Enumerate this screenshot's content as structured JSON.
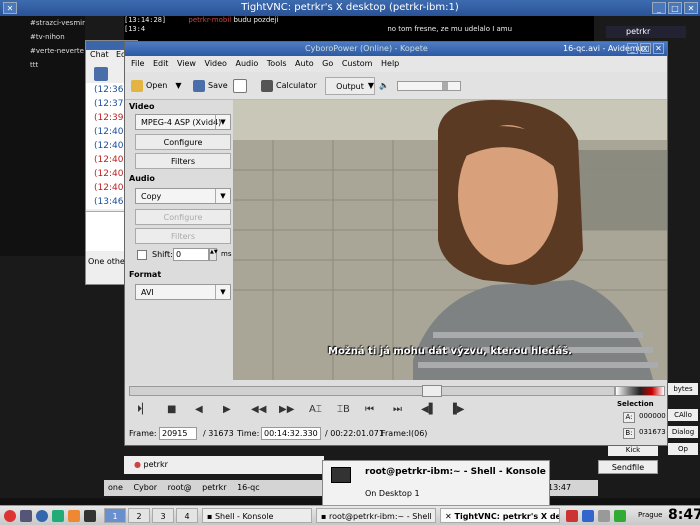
{
  "vnc": {
    "title": "TightVNC: petrkr's X desktop (petrkr-ibm:1)"
  },
  "irc": {
    "channels": [
      "#strazci-vesmiru",
      "#tv-nihon",
      "#verte-neverte",
      "ttt"
    ],
    "log": [
      {
        "time": "[13:14:28]",
        "nick": "petrkr-mobil",
        "text": "budu pozdeji"
      },
      {
        "time": "[13:4",
        "nick": "",
        "text": "no tom fresne, ze mu udelalo I amu"
      }
    ],
    "right_nick": "petrkr",
    "right_buttons": [
      "bytes",
      "CAllo",
      "Dialog",
      "Op",
      "Kick",
      "Sendfile"
    ]
  },
  "kopete": {
    "title": "CyboroPower (Online) - Kopete",
    "menu": [
      "Chat",
      "Edit"
    ],
    "times": [
      "(12:36:",
      "(12:37:",
      "(12:39:",
      "(12:40:",
      "(12:40:",
      "(12:40:",
      "(12:40:",
      "(12:40:",
      "(13:46:"
    ],
    "time_colors": [
      "#1a4fa0",
      "#1a4fa0",
      "#c02020",
      "#1a4fa0",
      "#1a4fa0",
      "#c02020",
      "#c02020",
      "#c02020",
      "#1a4fa0"
    ],
    "other_label": "One other p",
    "input_nick": "petrkr"
  },
  "avidemux": {
    "title": "16-qc.avi - Avidemux",
    "menu": [
      "File",
      "Edit",
      "View",
      "Video",
      "Audio",
      "Tools",
      "Auto",
      "Go",
      "Custom",
      "Help"
    ],
    "toolbar": {
      "open": "Open",
      "save": "Save",
      "calculator": "Calculator",
      "output": "Output"
    },
    "video_label": "Video",
    "video_codec": "MPEG-4 ASP (Xvid4)",
    "configure": "Configure",
    "filters": "Filters",
    "audio_label": "Audio",
    "audio_codec": "Copy",
    "shift_label": "Shift:",
    "shift_value": "0",
    "shift_unit": "ms",
    "format_label": "Format",
    "format_value": "AVI",
    "subtitle": "Možná ti já mohu dát výzvu, kterou hledáš.",
    "frame_label": "Frame:",
    "frame_value": "20915",
    "frame_total": "/ 31673",
    "time_label": "Time:",
    "time_value": "00:14:32.330",
    "time_total": "/ 00:22:01.071",
    "frame_type": "Frame:I(06)",
    "selection_label": "Selection",
    "sel_a_label": "A:",
    "sel_a": "000000",
    "sel_b_label": "B:",
    "sel_b": "031673",
    "seek_position": 0.63
  },
  "notification": {
    "title": "root@petrkr-ibm:~ - Shell - Konsole",
    "subtitle": "On Desktop 1"
  },
  "remote_taskbar": [
    "one",
    "Cybor",
    "root@",
    "petrkr",
    "16-qc",
    "13:47"
  ],
  "taskbar": {
    "pager": [
      "1",
      "2",
      "3",
      "4"
    ],
    "items": [
      "Shell - Konsole",
      "root@petrkr-ibm:~ - Shell",
      "TightVNC: petrkr's X de"
    ],
    "location": "Prague",
    "clock": "8:47"
  }
}
